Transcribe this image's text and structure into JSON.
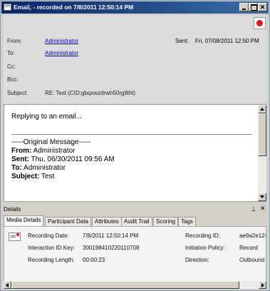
{
  "window": {
    "title": "Email, - recorded on 7/8/2011 12:50:14 PM",
    "icons": {
      "app": "email-window-icon",
      "minimize": "minimize-icon",
      "maximize": "maximize-icon",
      "close": "close-icon",
      "record": "record-icon"
    }
  },
  "header": {
    "from_label": "From:",
    "from_value": "Administrator",
    "to_label": "To:",
    "to_value": "Administrator",
    "cc_label": "Cc:",
    "cc_value": "",
    "bcc_label": "Bcc:",
    "bcc_value": "",
    "subject_label": "Subject:",
    "subject_value": "RE: Test (CID:gbqxwzdrwh50rg9thl)",
    "sent_label": "Sent:",
    "sent_value": "Fri, 07/08/2011 12:50 PM"
  },
  "body": {
    "line1": "Replying to an email...",
    "orig_header": "-----Original Message-----",
    "from_key": "From:",
    "from_val": " Administrator",
    "sent_key": "Sent:",
    "sent_val": " Thu, 06/30/2011 09:56 AM",
    "to_key": "To:",
    "to_val": " Administrator",
    "subject_key": "Subject:",
    "subject_val": " Test"
  },
  "details": {
    "title": "Details",
    "pin_icon": "pin-icon",
    "close_icon": "close-icon",
    "tabs": [
      "Media Details",
      "Participant Data",
      "Attributes",
      "Audit Trail",
      "Scoring",
      "Tags"
    ],
    "active_tab": "Media Details",
    "recording_date_label": "Recording Date:",
    "recording_date_value": "7/8/2011 12:50:14 PM",
    "interaction_id_label": "Interaction ID Key:",
    "interaction_id_value": "300198410220110708",
    "recording_length_label": "Recording Length:",
    "recording_length_value": "00:00:23",
    "recording_id_label": "Recording ID:",
    "recording_id_value": "ae9a2e12-",
    "initiation_policy_label": "Initiation Policy:",
    "initiation_policy_value": "Record",
    "direction_label": "Direction:",
    "direction_value": "Outbound"
  },
  "colors": {
    "titlebar_start": "#0a246a",
    "titlebar_end": "#3a6ea5",
    "link": "#0000cc",
    "record_red": "#e8101c"
  }
}
